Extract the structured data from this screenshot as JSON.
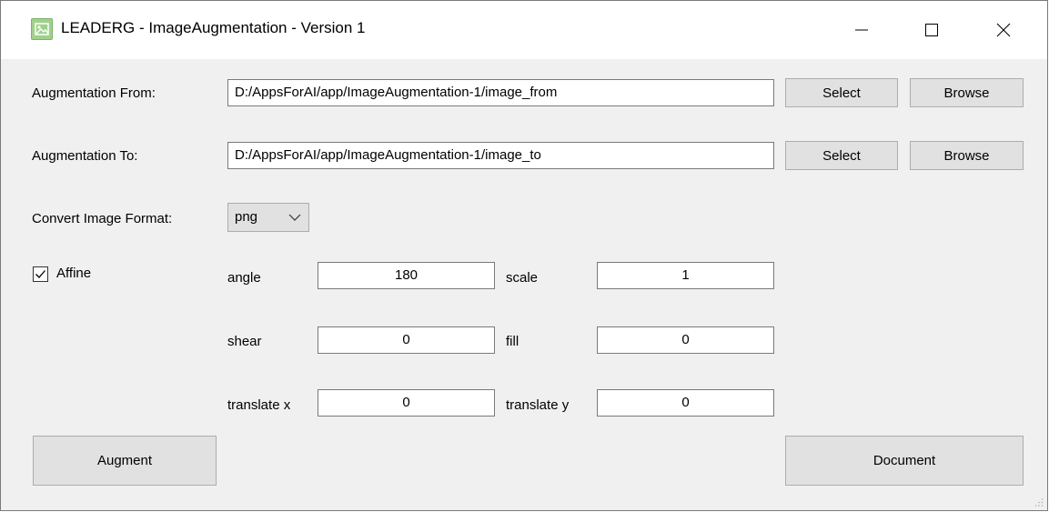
{
  "window": {
    "title": "LEADERG - ImageAugmentation - Version 1",
    "controls": {
      "minimize": "—",
      "maximize": "☐",
      "close": "✕"
    }
  },
  "augmentation_from": {
    "label": "Augmentation From:",
    "value": "D:/AppsForAI/app/ImageAugmentation-1/image_from",
    "select_label": "Select",
    "browse_label": "Browse"
  },
  "augmentation_to": {
    "label": "Augmentation To:",
    "value": "D:/AppsForAI/app/ImageAugmentation-1/image_to",
    "select_label": "Select",
    "browse_label": "Browse"
  },
  "convert_format": {
    "label": "Convert Image Format:",
    "selected": "png"
  },
  "affine": {
    "checkbox_label": "Affine",
    "checked": true,
    "angle": {
      "label": "angle",
      "value": "180"
    },
    "scale": {
      "label": "scale",
      "value": "1"
    },
    "shear": {
      "label": "shear",
      "value": "0"
    },
    "fill": {
      "label": "fill",
      "value": "0"
    },
    "translate_x": {
      "label": "translate x",
      "value": "0"
    },
    "translate_y": {
      "label": "translate y",
      "value": "0"
    }
  },
  "actions": {
    "augment_label": "Augment",
    "document_label": "Document"
  },
  "colors": {
    "window_bg": "#f0f0f0",
    "titlebar_bg": "#ffffff",
    "button_bg": "#e1e1e1",
    "field_border": "#7a7a7a"
  }
}
